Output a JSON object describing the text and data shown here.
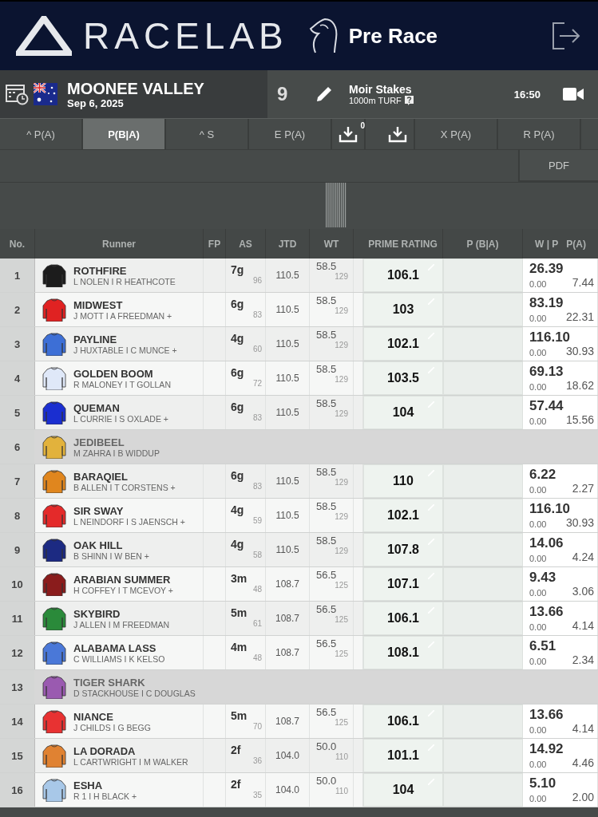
{
  "header": {
    "logo": "RACELAB",
    "title": "Pre Race"
  },
  "race": {
    "venue": "MOONEE VALLEY",
    "date": "Sep 6, 2025",
    "number": "9",
    "name": "Moir Stakes",
    "details": "1000m TURF",
    "time": "16:50"
  },
  "tabs": [
    {
      "kind": "text",
      "label": "^ P(A)",
      "selected": false
    },
    {
      "kind": "text",
      "label": "P(B|A)",
      "selected": true
    },
    {
      "kind": "text",
      "label": "^ S",
      "selected": false
    },
    {
      "kind": "text",
      "label": "E P(A)",
      "selected": false
    },
    {
      "kind": "download",
      "badge": "0",
      "selected": false
    },
    {
      "kind": "download",
      "selected": false
    },
    {
      "kind": "text",
      "label": "X P(A)",
      "selected": false
    },
    {
      "kind": "text",
      "label": "R P(A)",
      "selected": false
    }
  ],
  "pdf_button": "PDF",
  "table": {
    "columns": [
      "No.",
      "Runner",
      "FP",
      "AS",
      "JTD",
      "WT",
      "PRIME RATING",
      "P (B|A)",
      "W | P",
      "P(A)"
    ],
    "rows": [
      {
        "no": "1",
        "name": "ROTHFIRE",
        "people": "L NOLEN I R HEATHCOTE",
        "scratched": false,
        "color": "#1c1c1c",
        "as": "7g",
        "as_sub": "96",
        "jtd": "110.5",
        "wt": "58.5",
        "wt_sub": "129",
        "prime": "106.1",
        "win": "26.39",
        "place": "0.00",
        "pa": "7.44"
      },
      {
        "no": "2",
        "name": "MIDWEST",
        "people": "J MOTT I A FREEDMAN +",
        "scratched": false,
        "color": "#e02222",
        "as": "6g",
        "as_sub": "83",
        "jtd": "110.5",
        "wt": "58.5",
        "wt_sub": "129",
        "prime": "103",
        "win": "83.19",
        "place": "0.00",
        "pa": "22.31"
      },
      {
        "no": "3",
        "name": "PAYLINE",
        "people": "J HUXTABLE I C MUNCE +",
        "scratched": false,
        "color": "#3d6fd6",
        "as": "4g",
        "as_sub": "60",
        "jtd": "110.5",
        "wt": "58.5",
        "wt_sub": "129",
        "prime": "102.1",
        "win": "116.10",
        "place": "0.00",
        "pa": "30.93"
      },
      {
        "no": "4",
        "name": "GOLDEN BOOM",
        "people": "R MALONEY I T GOLLAN",
        "scratched": false,
        "color": "#dfe8f8",
        "as": "6g",
        "as_sub": "72",
        "jtd": "110.5",
        "wt": "58.5",
        "wt_sub": "129",
        "prime": "103.5",
        "win": "69.13",
        "place": "0.00",
        "pa": "18.62"
      },
      {
        "no": "5",
        "name": "QUEMAN",
        "people": "L CURRIE I S OXLADE +",
        "scratched": false,
        "color": "#1a2ed0",
        "as": "6g",
        "as_sub": "83",
        "jtd": "110.5",
        "wt": "58.5",
        "wt_sub": "129",
        "prime": "104",
        "win": "57.44",
        "place": "0.00",
        "pa": "15.56"
      },
      {
        "no": "6",
        "name": "JEDIBEEL",
        "people": "M ZAHRA I B WIDDUP",
        "scratched": true,
        "color": "#e2b23c"
      },
      {
        "no": "7",
        "name": "BARAQIEL",
        "people": "B ALLEN I T CORSTENS +",
        "scratched": false,
        "color": "#e0861e",
        "as": "6g",
        "as_sub": "83",
        "jtd": "110.5",
        "wt": "58.5",
        "wt_sub": "129",
        "prime": "110",
        "win": "6.22",
        "place": "0.00",
        "pa": "2.27"
      },
      {
        "no": "8",
        "name": "SIR SWAY",
        "people": "L NEINDORF I S JAENSCH +",
        "scratched": false,
        "color": "#e42a2a",
        "as": "4g",
        "as_sub": "59",
        "jtd": "110.5",
        "wt": "58.5",
        "wt_sub": "129",
        "prime": "102.1",
        "win": "116.10",
        "place": "0.00",
        "pa": "30.93"
      },
      {
        "no": "9",
        "name": "OAK HILL",
        "people": "B SHINN I W BEN +",
        "scratched": false,
        "color": "#1c2a82",
        "as": "4g",
        "as_sub": "58",
        "jtd": "110.5",
        "wt": "58.5",
        "wt_sub": "129",
        "prime": "107.8",
        "win": "14.06",
        "place": "0.00",
        "pa": "4.24"
      },
      {
        "no": "10",
        "name": "ARABIAN SUMMER",
        "people": "H COFFEY I T MCEVOY +",
        "scratched": false,
        "color": "#8a1c1c",
        "as": "3m",
        "as_sub": "48",
        "jtd": "108.7",
        "wt": "56.5",
        "wt_sub": "125",
        "prime": "107.1",
        "win": "9.43",
        "place": "0.00",
        "pa": "3.06"
      },
      {
        "no": "11",
        "name": "SKYBIRD",
        "people": "J ALLEN I M FREEDMAN",
        "scratched": false,
        "color": "#2a8a3a",
        "as": "5m",
        "as_sub": "61",
        "jtd": "108.7",
        "wt": "56.5",
        "wt_sub": "125",
        "prime": "106.1",
        "win": "13.66",
        "place": "0.00",
        "pa": "4.14"
      },
      {
        "no": "12",
        "name": "ALABAMA LASS",
        "people": "C WILLIAMS I K KELSO",
        "scratched": false,
        "color": "#4a78d8",
        "as": "4m",
        "as_sub": "48",
        "jtd": "108.7",
        "wt": "56.5",
        "wt_sub": "125",
        "prime": "108.1",
        "win": "6.51",
        "place": "0.00",
        "pa": "2.34"
      },
      {
        "no": "13",
        "name": "TIGER SHARK",
        "people": "D STACKHOUSE I C DOUGLAS",
        "scratched": true,
        "color": "#9a5ab0"
      },
      {
        "no": "14",
        "name": "NIANCE",
        "people": "J CHILDS I G BEGG",
        "scratched": false,
        "color": "#e83232",
        "as": "5m",
        "as_sub": "70",
        "jtd": "108.7",
        "wt": "56.5",
        "wt_sub": "125",
        "prime": "106.1",
        "win": "13.66",
        "place": "0.00",
        "pa": "4.14"
      },
      {
        "no": "15",
        "name": "LA DORADA",
        "people": "L CARTWRIGHT I M WALKER",
        "scratched": false,
        "color": "#e08232",
        "as": "2f",
        "as_sub": "36",
        "jtd": "104.0",
        "wt": "50.0",
        "wt_sub": "110",
        "prime": "101.1",
        "win": "14.92",
        "place": "0.00",
        "pa": "4.46"
      },
      {
        "no": "16",
        "name": "ESHA",
        "people": "R 1 I H BLACK +",
        "scratched": false,
        "color": "#a8c8e8",
        "as": "2f",
        "as_sub": "35",
        "jtd": "104.0",
        "wt": "50.0",
        "wt_sub": "110",
        "prime": "104",
        "win": "5.10",
        "place": "0.00",
        "pa": "2.00"
      }
    ]
  }
}
